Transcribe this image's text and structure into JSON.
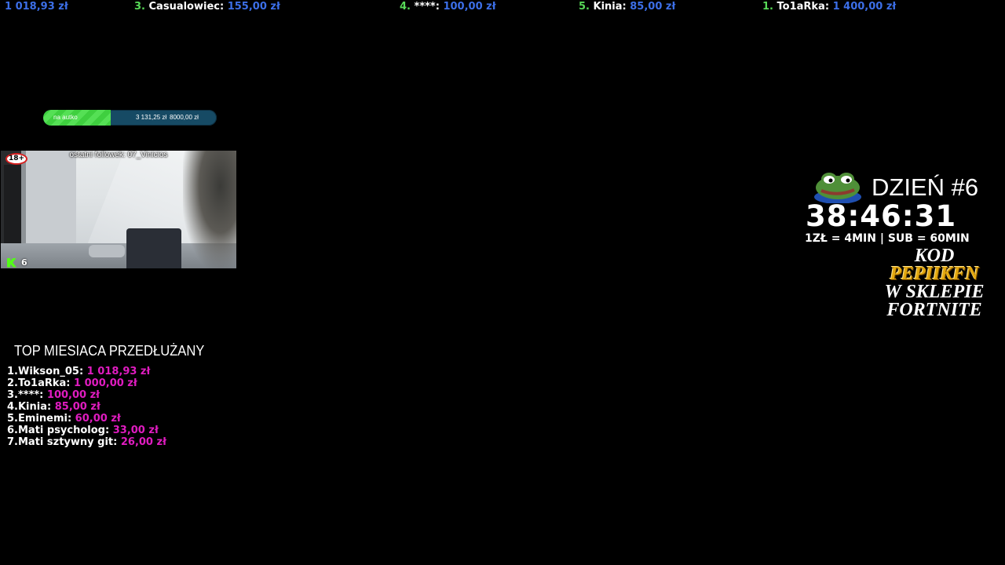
{
  "ticker": [
    {
      "num": "",
      "name": "",
      "amount": "1 018,93 zł"
    },
    {
      "num": "3.",
      "name": "Casualowiec:",
      "amount": "155,00 zł"
    },
    {
      "num": "4.",
      "name": "****:",
      "amount": "100,00 zł"
    },
    {
      "num": "5.",
      "name": "Kinia:",
      "amount": "85,00 zł"
    },
    {
      "num": "1.",
      "name": "To1aRka:",
      "amount": "1 400,00 zł"
    }
  ],
  "goal": {
    "label": "na autko",
    "current": "3 131,25 zł",
    "target": "8000,00 zł",
    "progress": 0.39
  },
  "webcam": {
    "last_follower": "ostatni followek: 07_Vinicios",
    "age_badge": "18+",
    "viewer_count": "6"
  },
  "timer_panel": {
    "day": "DZIEŃ #6",
    "time": "38:46:31",
    "rate": "1ZŁ = 4MIN | SUB = 60MIN",
    "promo_line1": "KOD",
    "promo_code": "PEPIIKFN",
    "promo_line3": "W SKLEPIE",
    "promo_line4": "FORTNITE"
  },
  "top_month": {
    "title": "TOP MIESIACA PRZEDŁUŻANY",
    "entries": [
      {
        "rank": "1.",
        "name": "Wikson_05:",
        "amount": "1 018,93 zł"
      },
      {
        "rank": "2.",
        "name": "To1aRka:",
        "amount": "1 000,00 zł"
      },
      {
        "rank": "3.",
        "name": "****:",
        "amount": "100,00 zł"
      },
      {
        "rank": "4.",
        "name": "Kinia:",
        "amount": "85,00 zł"
      },
      {
        "rank": "5.",
        "name": "Eminemi:",
        "amount": "60,00 zł"
      },
      {
        "rank": "6.",
        "name": "Mati psycholog:",
        "amount": "33,00 zł"
      },
      {
        "rank": "7.",
        "name": "Mati sztywny git:",
        "amount": "26,00 zł"
      }
    ]
  },
  "colors": {
    "background": "#000000",
    "ticker_rank": "#57d957",
    "ticker_amount": "#3c6fe8",
    "top_amount": "#e01cc0",
    "goal_fill": "#3fcf3f",
    "goal_track": "#164a64",
    "promo_code": "#e3a80f"
  }
}
